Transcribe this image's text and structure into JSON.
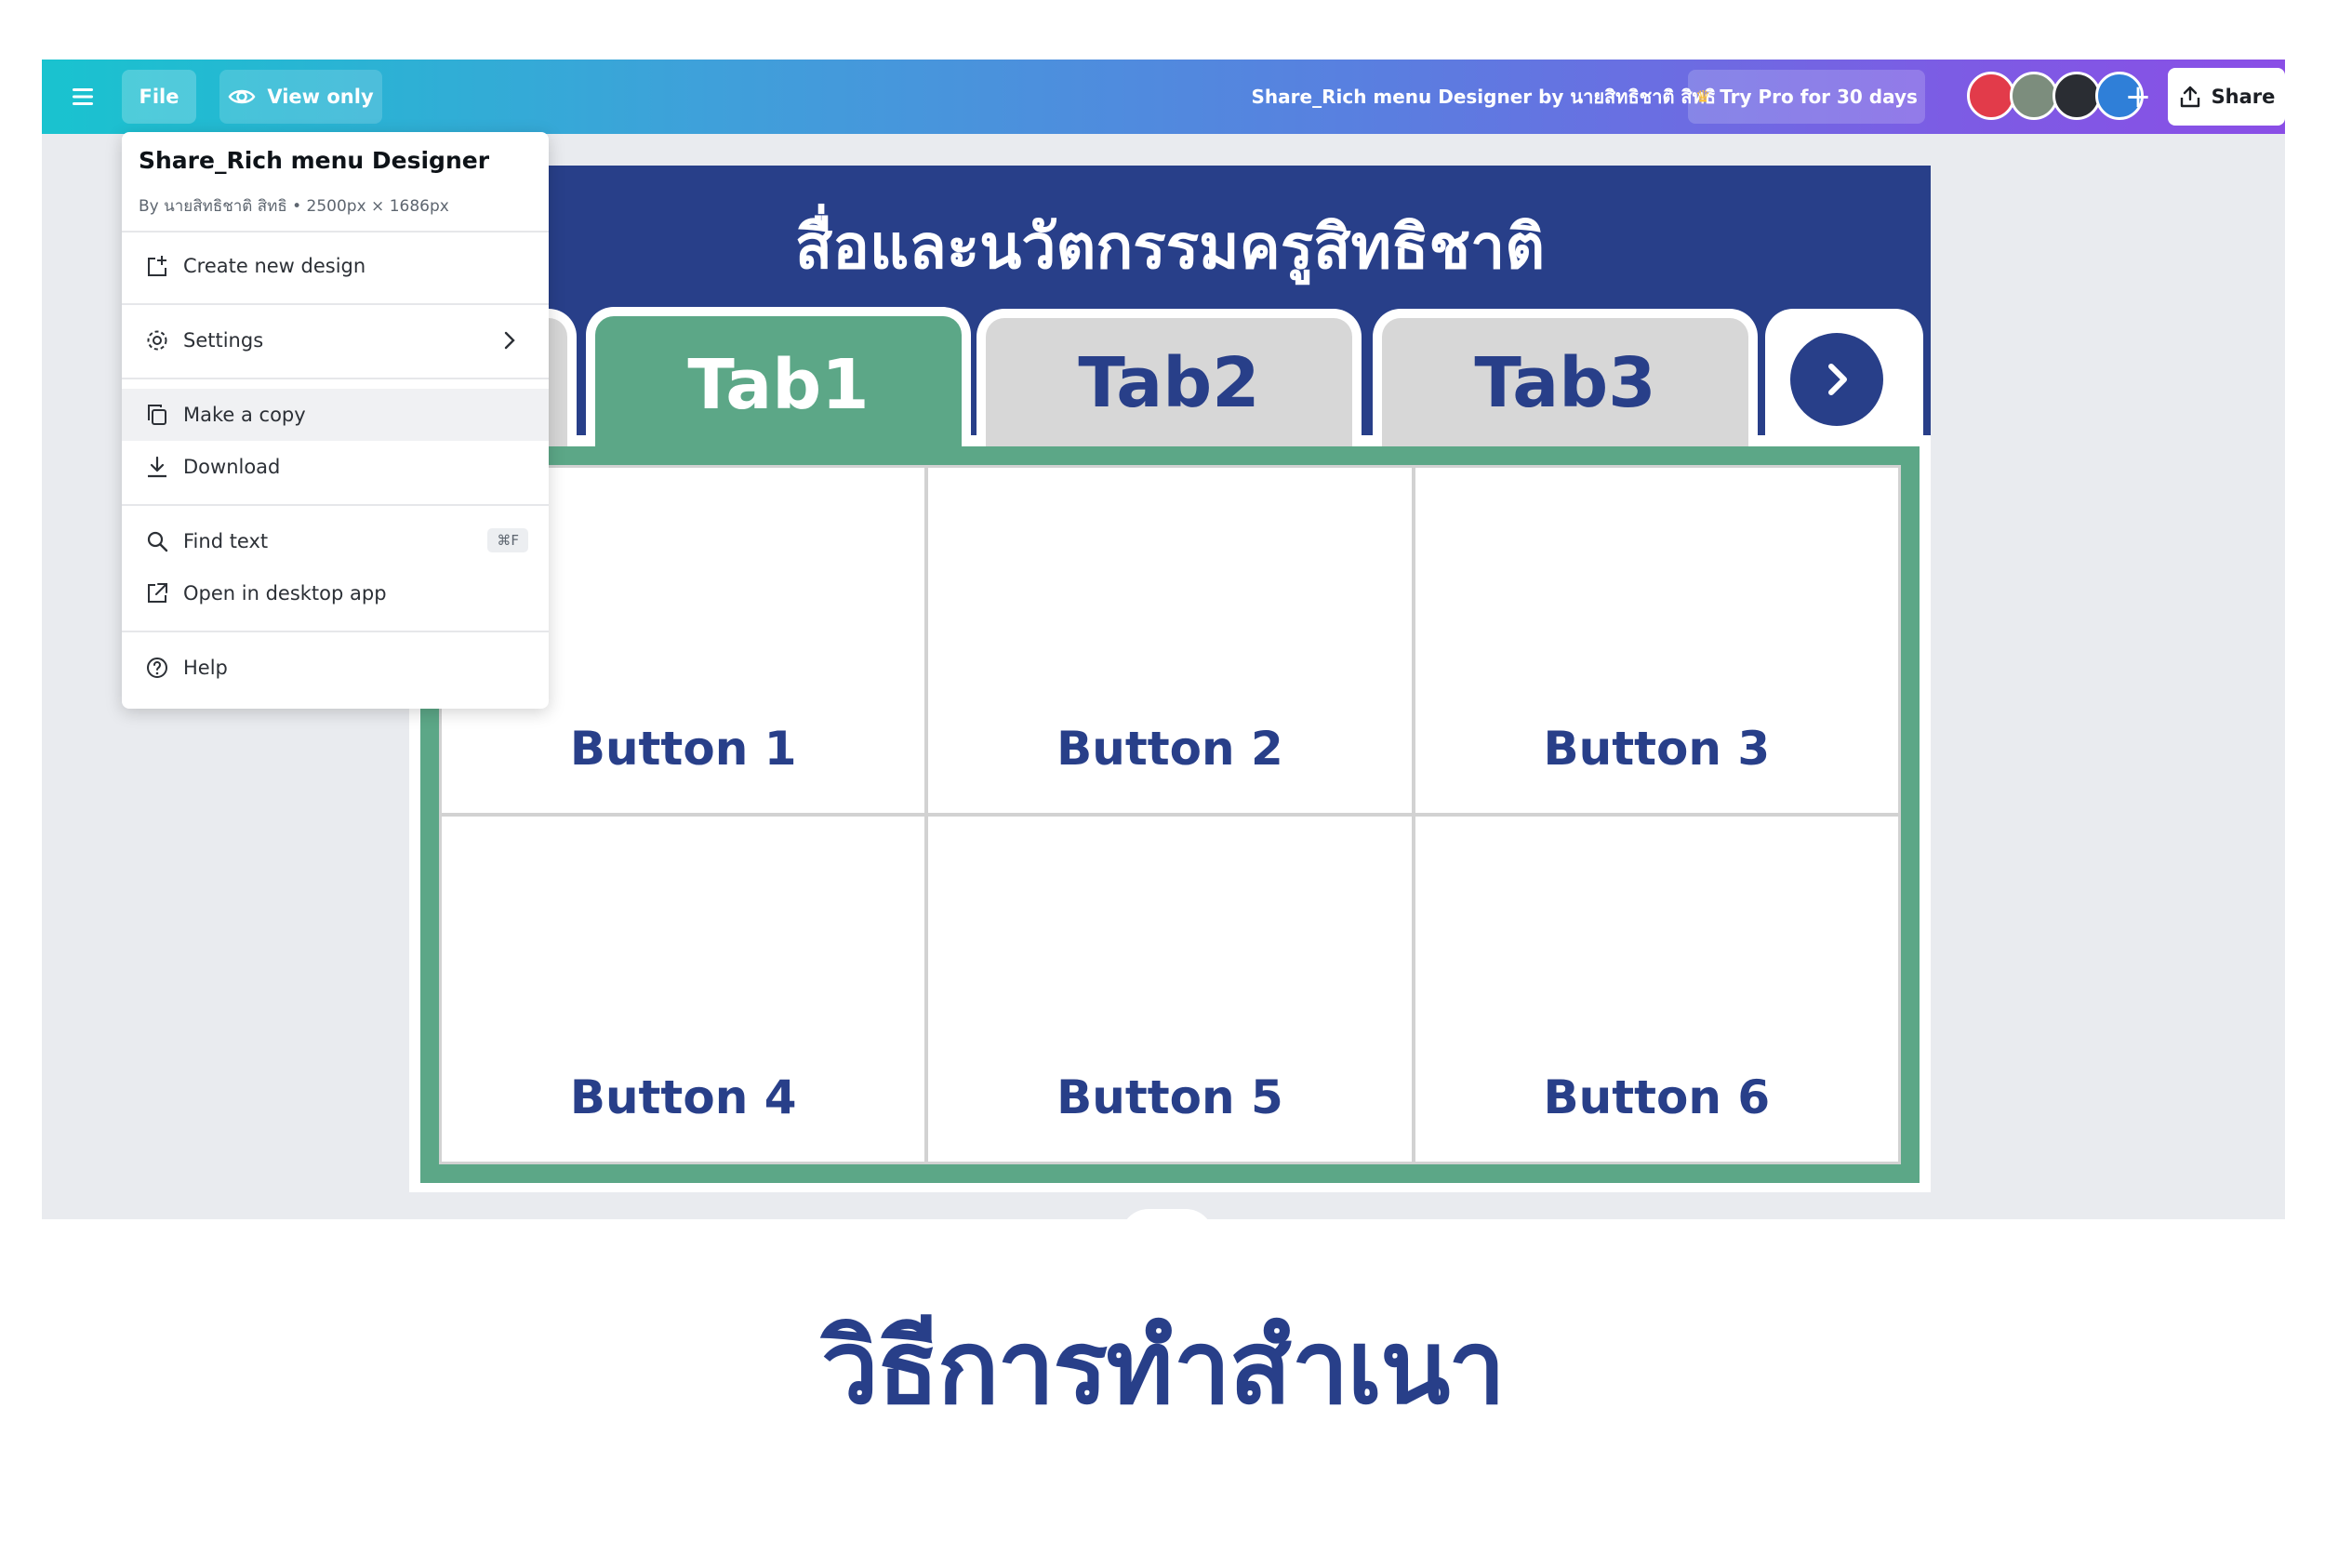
{
  "colors": {
    "brand_blue": "#283f89",
    "tab_green": "#5ca787",
    "tab_gray": "#d7d7d7",
    "topbar_start": "#19c3cf",
    "topbar_end": "#8a4ee6"
  },
  "topbar": {
    "file_label": "File",
    "view_only_label": "View only",
    "doc_title": "Share_Rich menu Designer by นายสิทธิชาติ สิทธิ",
    "pro_label": "Try Pro for 30 days",
    "share_label": "Share",
    "avatar_colors": [
      "#e23b4a",
      "#7c8d7d",
      "#2a2d33",
      "#2f7fd8"
    ]
  },
  "file_menu": {
    "title": "Share_Rich menu Designer",
    "subtitle": "By นายสิทธิชาติ สิทธิ • 2500px × 1686px",
    "items": [
      {
        "label": "Create new design"
      },
      {
        "label": "Settings"
      },
      {
        "label": "Make a copy"
      },
      {
        "label": "Download"
      },
      {
        "label": "Find text",
        "shortcut": "⌘F"
      },
      {
        "label": "Open in desktop app"
      },
      {
        "label": "Help"
      }
    ]
  },
  "design": {
    "title": "สื่อและนวัตกรรมครูสิทธิชาติ",
    "tabs": [
      "Tab1",
      "Tab2",
      "Tab3"
    ],
    "buttons": [
      "Button 1",
      "Button 2",
      "Button 3",
      "Button 4",
      "Button 5",
      "Button 6"
    ]
  },
  "caption": "วิธีการทำสำเนา"
}
